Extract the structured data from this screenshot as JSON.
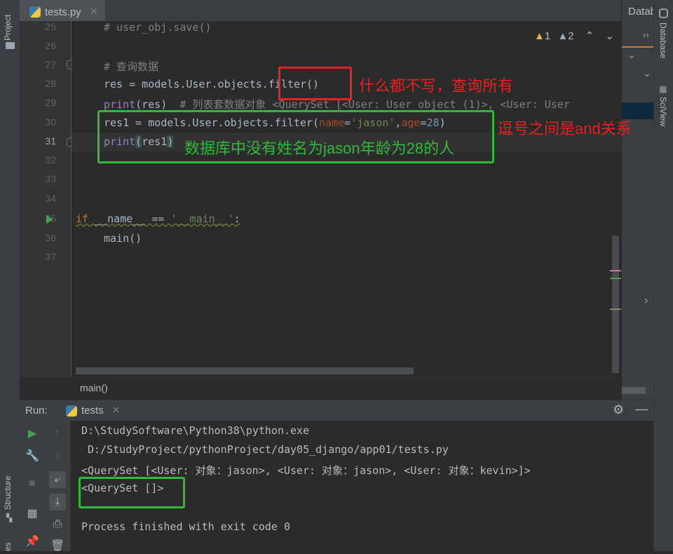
{
  "left_strip": {
    "project_label": "Project",
    "structure_label": "Structure",
    "favorites_label": "es"
  },
  "right_strip": {
    "database_label": "Database",
    "sciview_label": "SciView"
  },
  "db_panel": {
    "title": "Datab"
  },
  "tab": {
    "filename": "tests.py"
  },
  "inspections": {
    "warnings": "1",
    "weak_warnings": "2"
  },
  "editor": {
    "line_numbers": [
      "25",
      "26",
      "27",
      "28",
      "29",
      "30",
      "31",
      "32",
      "33",
      "34",
      "35",
      "36",
      "37"
    ],
    "current_line": "31",
    "l25": "# user_obj.save()",
    "l27": "# 查询数据",
    "l28_a": "res = models.User.objects.",
    "l28_b": "filter()",
    "l29_fn": "print",
    "l29_a": "(res)  ",
    "l29_cmt": "# 列表套数据对象 <QuerySet [<User: User object (1)>, <User: User",
    "l30_a": "res1 = models.User.objects.filter(",
    "l30_p1": "name",
    "l30_eq1": "=",
    "l30_s1": "'jason'",
    "l30_comma": ",",
    "l30_p2": "age",
    "l30_eq2": "=",
    "l30_n2": "28",
    "l30_close": ")",
    "l31_fn": "print",
    "l31_po": "(",
    "l31_arg": "res1",
    "l31_pc": ")",
    "l35_kw": "if",
    "l35_a": " __name__ == ",
    "l35_s": "'__main__'",
    "l35_b": ":",
    "l36": "main()"
  },
  "annotations": {
    "filter_note": "什么都不写，查询所有",
    "and_note": "逗号之间是and关系",
    "none_note": "数据库中没有姓名为jason年龄为28的人"
  },
  "breadcrumb": {
    "text": "main()"
  },
  "run": {
    "label": "Run:",
    "tab_name": "tests",
    "output": [
      "D:\\StudySoftware\\Python38\\python.exe",
      " D:/StudyProject/pythonProject/day05_django/app01/tests.py",
      "<QuerySet [<User: 对象：jason>, <User: 对象：jason>, <User: 对象：kevin>]>",
      "<QuerySet []>",
      "",
      "Process finished with exit code 0"
    ]
  },
  "colors": {
    "accent": "#4a88c7",
    "annotation_red": "#e8201f",
    "annotation_green": "#2fb83a"
  }
}
